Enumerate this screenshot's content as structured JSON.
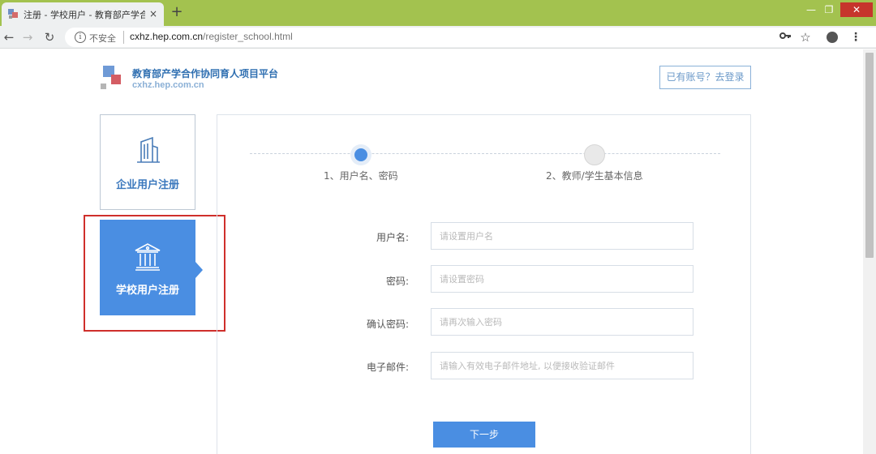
{
  "browser": {
    "tab_title": "注册 - 学校用户 - 教育部产学合作",
    "tab_close": "×",
    "new_tab": "+",
    "window_controls": {
      "minimize": "—",
      "maximize": "❐",
      "close": "✕"
    },
    "nav": {
      "back": "←",
      "forward": "→",
      "reload": "↻"
    },
    "security_icon": "i",
    "security_text": "不安全",
    "url_host": "cxhz.hep.com.cn",
    "url_path": "/register_school.html",
    "toolbar_icons": {
      "key": "key-icon",
      "star": "☆",
      "account": "account-icon",
      "menu": "⋮"
    },
    "accent_color": "#a3c24f"
  },
  "header": {
    "site_title": "教育部产学合作协同育人项目平台",
    "site_url": "cxhz.hep.com.cn",
    "login_link": "已有账号？去登录"
  },
  "sidebar": {
    "company": {
      "label": "企业用户注册",
      "icon": "building-icon"
    },
    "school": {
      "label": "学校用户注册",
      "icon": "school-icon",
      "active": true
    }
  },
  "steps": [
    {
      "label": "1、用户名、密码",
      "active": true
    },
    {
      "label": "2、教师/学生基本信息",
      "active": false
    }
  ],
  "form": {
    "username": {
      "label": "用户名:",
      "placeholder": "请设置用户名",
      "value": ""
    },
    "password": {
      "label": "密码:",
      "placeholder": "请设置密码",
      "value": ""
    },
    "confirm_password": {
      "label": "确认密码:",
      "placeholder": "请再次输入密码",
      "value": ""
    },
    "email": {
      "label": "电子邮件:",
      "placeholder": "请输入有效电子邮件地址, 以便接收验证邮件",
      "value": ""
    },
    "submit": "下一步"
  },
  "colors": {
    "primary": "#4a8ee2",
    "highlight_box": "#cf2f2b"
  }
}
